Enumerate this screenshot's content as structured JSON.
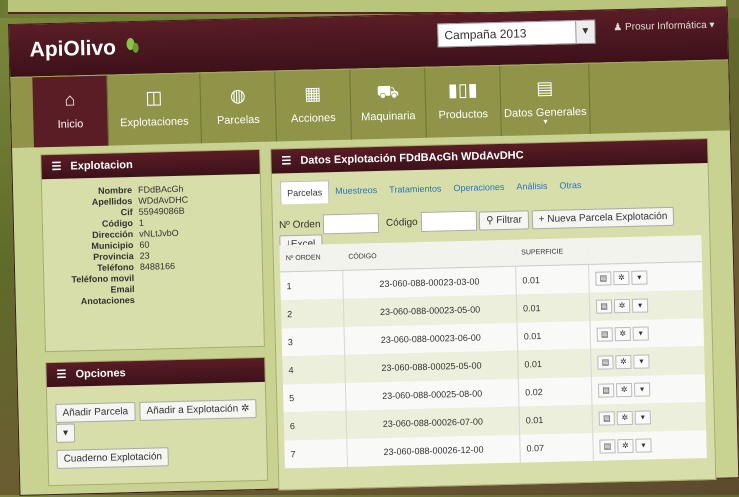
{
  "app": {
    "title": "ApiOlivo"
  },
  "header": {
    "campaign": "Campaña 2013",
    "user": "Prosur Informática"
  },
  "nav": {
    "items": [
      {
        "label": "Inicio",
        "icon": "home-icon",
        "glyph": "⌂"
      },
      {
        "label": "Explotaciones",
        "icon": "columns-icon",
        "glyph": "◫"
      },
      {
        "label": "Parcelas",
        "icon": "globe-icon",
        "glyph": "◍"
      },
      {
        "label": "Acciones",
        "icon": "chart-icon",
        "glyph": "▦"
      },
      {
        "label": "Maquinaria",
        "icon": "truck-icon",
        "glyph": "⛟"
      },
      {
        "label": "Productos",
        "icon": "barcode-icon",
        "glyph": "▮▯▮"
      },
      {
        "label": "Datos Generales",
        "icon": "book-icon",
        "glyph": "▤"
      }
    ]
  },
  "explotacion": {
    "title": "Explotacion",
    "fields": [
      {
        "k": "Nombre",
        "v": "FDdBAcGh"
      },
      {
        "k": "Apellidos",
        "v": "WDdAvDHC"
      },
      {
        "k": "Cif",
        "v": "55949086B"
      },
      {
        "k": "Código",
        "v": "1"
      },
      {
        "k": "Dirección",
        "v": "vNLtJvbO"
      },
      {
        "k": "Municipio",
        "v": "60"
      },
      {
        "k": "Provincia",
        "v": "23"
      },
      {
        "k": "Teléfono",
        "v": "8488166"
      },
      {
        "k": "Teléfono movil",
        "v": ""
      },
      {
        "k": "Email",
        "v": ""
      },
      {
        "k": "Anotaciones",
        "v": ""
      }
    ]
  },
  "opciones": {
    "title": "Opciones",
    "add_parcel": "Añadir Parcela",
    "add_to": "Añadir a Explotación",
    "notebook": "Cuaderno Explotación"
  },
  "datos": {
    "title": "Datos Explotación FDdBAcGh WDdAvDHC",
    "tabs": [
      "Parcelas",
      "Muestreos",
      "Tratamientos",
      "Operaciones",
      "Análisis",
      "Otras"
    ],
    "filter_order": "Nº Orden",
    "filter_code": "Código",
    "filter_btn": "Filtrar",
    "new_btn": "+ Nueva Parcela Explotación",
    "excel_btn": "Excel",
    "columns": [
      "Nº ORDEN",
      "CÓDIGO",
      "SUPERFICIE",
      ""
    ],
    "rows": [
      {
        "n": "1",
        "c": "23-060-088-00023-03-00",
        "s": "0.01"
      },
      {
        "n": "2",
        "c": "23-060-088-00023-05-00",
        "s": "0.01"
      },
      {
        "n": "3",
        "c": "23-060-088-00023-06-00",
        "s": "0.01"
      },
      {
        "n": "4",
        "c": "23-060-088-00025-05-00",
        "s": "0.01"
      },
      {
        "n": "5",
        "c": "23-060-088-00025-08-00",
        "s": "0.02"
      },
      {
        "n": "6",
        "c": "23-060-088-00026-07-00",
        "s": "0.01"
      },
      {
        "n": "7",
        "c": "23-060-088-00026-12-00",
        "s": "0.07"
      }
    ]
  }
}
